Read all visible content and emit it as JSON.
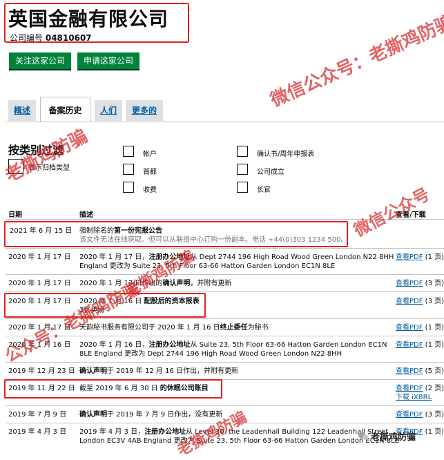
{
  "header": {
    "company_name": "英国金融有限公司",
    "company_number_label": "公司编号",
    "company_number": "04810607"
  },
  "actions": {
    "follow": "关注这家公司",
    "apply": "申请这家公司"
  },
  "tabs": [
    {
      "label": "概述"
    },
    {
      "label": "备案历史"
    },
    {
      "label": "人们"
    },
    {
      "label": "更多的"
    }
  ],
  "filters": {
    "title": "按类别过滤",
    "show_archived": "显示归档类型",
    "categories": [
      "帐户",
      "首都",
      "收费",
      "确认书/周年申报表",
      "公司成立",
      "长官"
    ]
  },
  "table": {
    "headers": {
      "date": "日期",
      "description": "描述",
      "view": "查看/下载"
    },
    "view_pdf": "查看PDF",
    "download_ixbrl": "下载 iXBRL",
    "rows": [
      {
        "date": "2021 年 6 月 15 日",
        "desc1": "强制除名的第一份宪报公告",
        "desc2": "该文件无法在线获取。但可以从联络中心订购一份副本。电话 +44(0)303 1234 500。",
        "pages": ""
      },
      {
        "date": "2020 年 1 月 17 日",
        "desc1": "2020 年 1 月 17 日，注册办公地址从 Dept 2744 196 High Road Wood Green London N22 8HH",
        "desc2": "England 更改为 Suite 23, 5th Floor 63-66 Hatton Garden London EC1N 8LE",
        "pages": "(1 页)"
      },
      {
        "date": "2020 年 1 月 17 日",
        "desc1": "2020 年 1 月 17 日作出的确认声明，并附有更新",
        "desc2": "",
        "pages": "(3 页)"
      },
      {
        "date": "2020 年 1 月 17 日",
        "desc1": "2020 年 1 月 16 日 配股后的资本报表",
        "desc2": "2亿英镑",
        "pages": "(3 页)"
      },
      {
        "date": "2020 年 1 月 17 日",
        "desc1": "天韵秘书服务有限公司于 2020 年 1 月 16 日终止委任为秘书",
        "desc2": "",
        "pages": "(1 页)"
      },
      {
        "date": "2020 年 1 月 16 日",
        "desc1": "2020 年 1 月 16 日，注册办公地址从 Suite 23, 5th Floor 63-66 Hatton Garden London EC1N",
        "desc2": "8LE England 更改为 Dept 2744 196 High Road Wood Green London N22 8HH",
        "pages": "(1 页)"
      },
      {
        "date": "2019 年 12 月 23 日",
        "desc1": "确认声明于 2019 年 12 月 16 日作出，并附有更新",
        "desc2": "",
        "pages": "(5 页)"
      },
      {
        "date": "2019 年 11 月 22 日",
        "desc1": "截至 2019 年 6 月 30 日 的休眠公司账目",
        "desc2": "",
        "pages": "(2 页)"
      },
      {
        "date": "2019 年 7 月 9 日",
        "desc1": "确认声明于 2019 年 7 月 9 日作出，没有更新",
        "desc2": "",
        "pages": "(3 页)"
      },
      {
        "date": "2019 年 4 月 3 日",
        "desc1": "2019 年 4 月 3 日，注册办公地址从 Level 30, the Leadenhall Building 122 Leadenhall Street",
        "desc2": "London EC3V 4AB England 更改为 Suite 23, 5th Floor 63-66 Hatton Garden London EC1N 8LE",
        "pages": "(1 页)"
      }
    ]
  },
  "watermarks": {
    "wechat_full": "微信公众号：老撕鸡防骗",
    "wechat_short": "微信公众号",
    "name": "老撕鸡防骗",
    "public_account": "公众号：老撕鸡防骗",
    "brand_badge": "老撕鸡防骗"
  },
  "colors": {
    "accent_green": "#00823b",
    "link_blue": "#005ea5",
    "highlight_red": "#e0201b"
  }
}
